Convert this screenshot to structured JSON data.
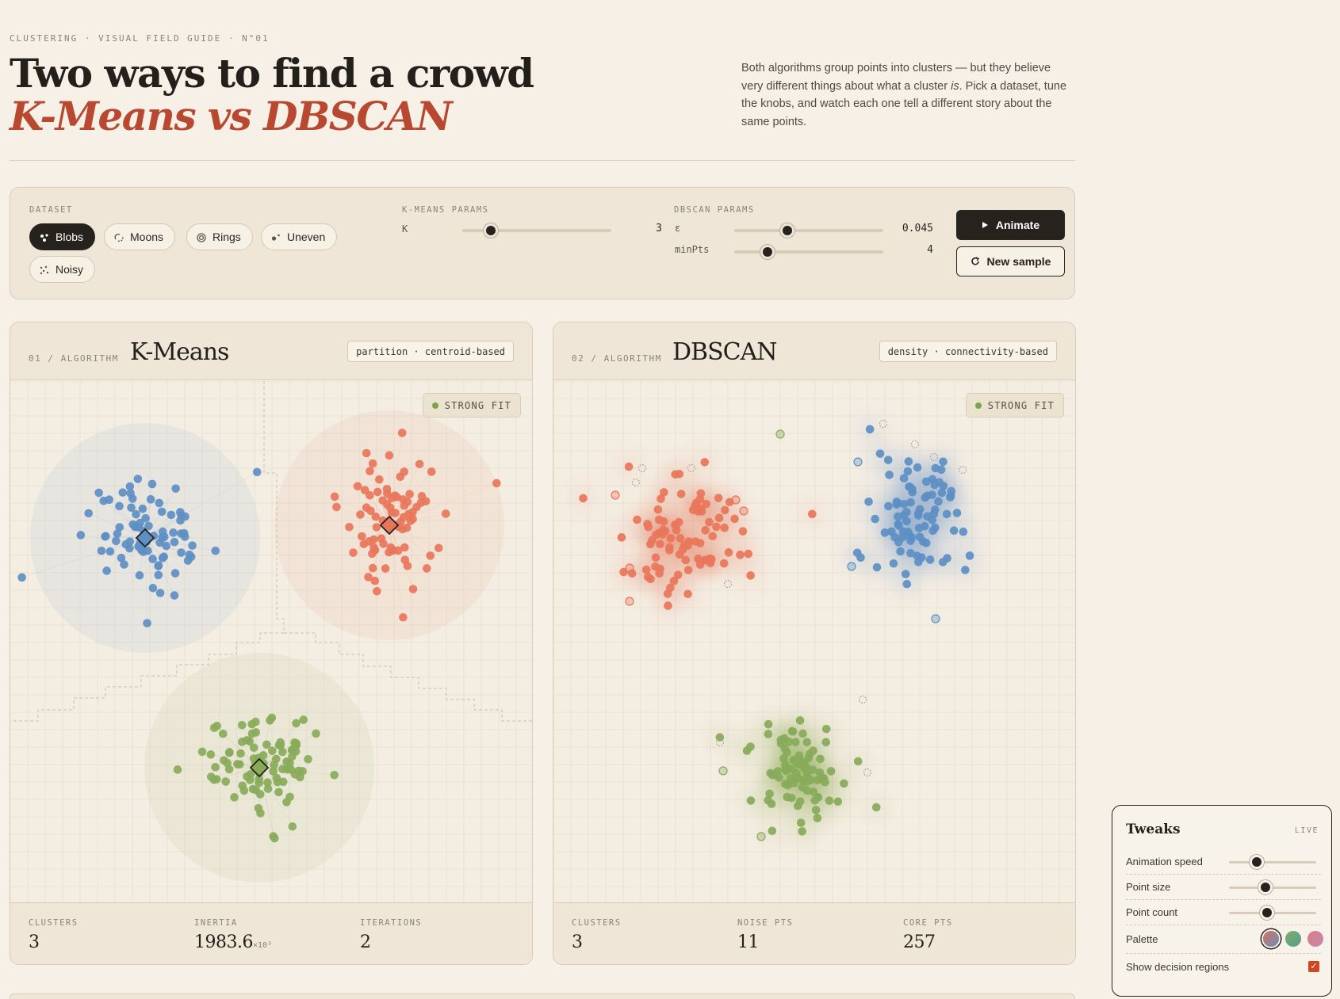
{
  "header": {
    "eyebrow": "CLUSTERING · VISUAL FIELD GUIDE · N°01",
    "title_line1": "Two ways to find a crowd",
    "title_line2": "K-Means vs DBSCAN",
    "intro_pre": "Both algorithms group points into clusters — but they believe very different things about what a cluster ",
    "intro_em": "is",
    "intro_post": ". Pick a dataset, tune the knobs, and watch each one tell a different story about the same points."
  },
  "controls": {
    "dataset_label": "DATASET",
    "datasets": [
      {
        "label": "Blobs",
        "icon": "blobs-icon",
        "active": true
      },
      {
        "label": "Moons",
        "icon": "moons-icon",
        "active": false
      },
      {
        "label": "Rings",
        "icon": "rings-icon",
        "active": false
      },
      {
        "label": "Uneven",
        "icon": "uneven-icon",
        "active": false
      },
      {
        "label": "Noisy",
        "icon": "noisy-icon",
        "active": false
      }
    ],
    "kmeans_label": "K-MEANS PARAMS",
    "k_label": "K",
    "k_value": "3",
    "dbscan_label": "DBSCAN PARAMS",
    "eps_label": "ε",
    "eps_value": "0.045",
    "minpts_label": "minPts",
    "minpts_value": "4",
    "animate_label": "Animate",
    "new_sample_label": "New sample"
  },
  "kmeans": {
    "num": "01 / ALGORITHM",
    "name": "K-Means",
    "tag": "partition · centroid-based",
    "fit": "STRONG FIT",
    "stats": [
      {
        "label": "CLUSTERS",
        "value": "3",
        "unit": ""
      },
      {
        "label": "INERTIA",
        "value": "1983.6",
        "unit": "×10³"
      },
      {
        "label": "ITERATIONS",
        "value": "2",
        "unit": ""
      }
    ]
  },
  "dbscan": {
    "num": "02 / ALGORITHM",
    "name": "DBSCAN",
    "tag": "density · connectivity-based",
    "fit": "STRONG FIT",
    "stats": [
      {
        "label": "CLUSTERS",
        "value": "3"
      },
      {
        "label": "NOISE PTS",
        "value": "11"
      },
      {
        "label": "CORE PTS",
        "value": "257"
      }
    ]
  },
  "colors": {
    "blue": "#5e8fc4",
    "orange": "#e8765a",
    "green": "#88ab5a",
    "accent": "#b8482f",
    "ink": "#26221d"
  },
  "tweaks": {
    "title": "Tweaks",
    "live": "LIVE",
    "animation_speed_label": "Animation speed",
    "animation_speed": 0.32,
    "point_size_label": "Point size",
    "point_size": 0.42,
    "point_count_label": "Point count",
    "point_count": 0.44,
    "palette_label": "Palette",
    "palette_selected": 0,
    "decision_label": "Show decision regions",
    "decision_checked": true
  }
}
